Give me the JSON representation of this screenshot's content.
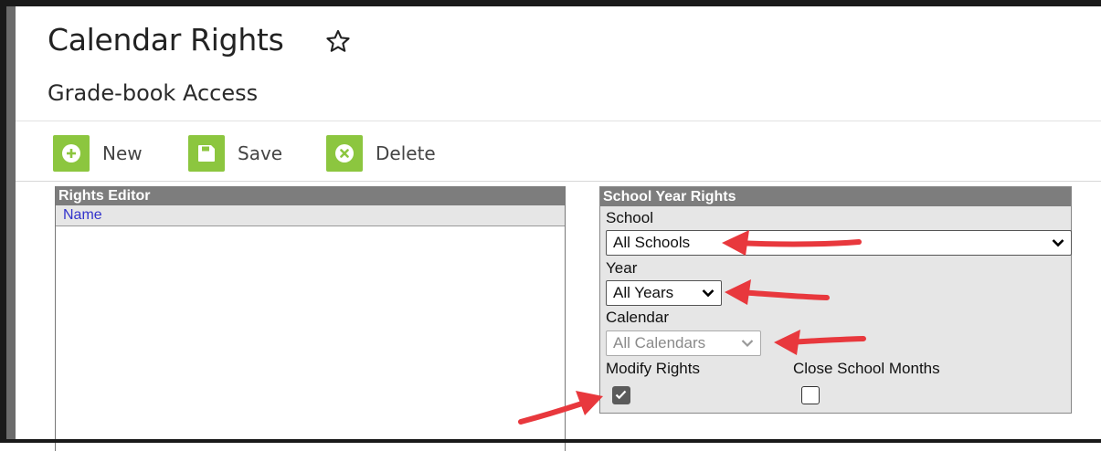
{
  "page": {
    "title": "Calendar Rights",
    "subtitle": "Grade-book Access",
    "star_icon": "star-outline-icon"
  },
  "toolbar": {
    "new_label": "New",
    "save_label": "Save",
    "delete_label": "Delete",
    "accent_color": "#8cc63f"
  },
  "rights_editor": {
    "title": "Rights Editor",
    "column_header": "Name"
  },
  "school_year_rights": {
    "title": "School Year Rights",
    "school_label": "School",
    "school_value": "All Schools",
    "year_label": "Year",
    "year_value": "All Years",
    "calendar_label": "Calendar",
    "calendar_value": "All Calendars",
    "calendar_disabled": true,
    "modify_rights_label": "Modify Rights",
    "modify_rights_checked": true,
    "close_school_months_label": "Close School Months",
    "close_school_months_checked": false
  },
  "annotation_color": "#e8383d"
}
